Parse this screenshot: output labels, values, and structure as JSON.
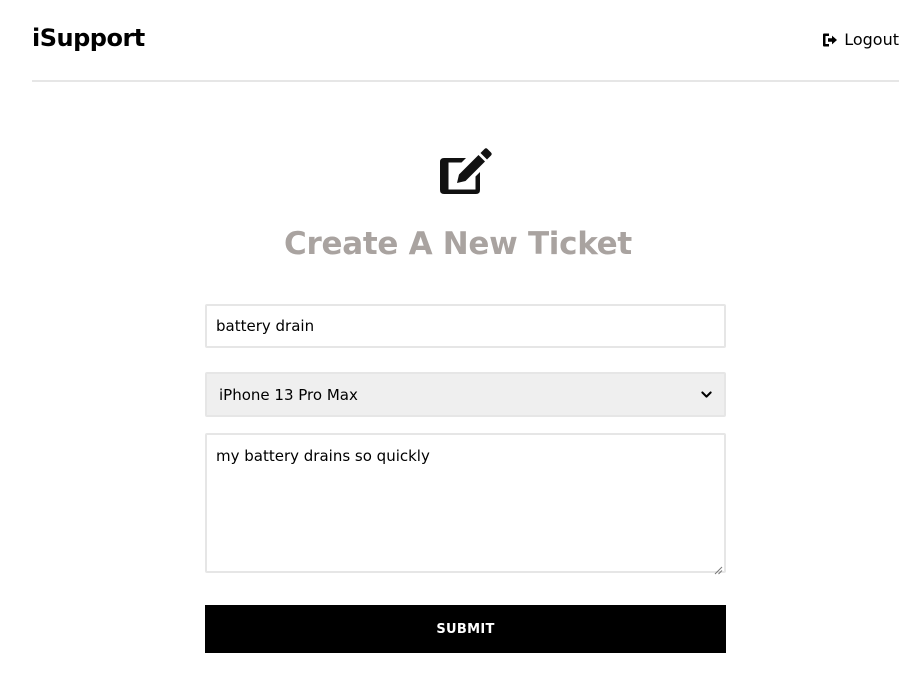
{
  "header": {
    "brand": "iSupport",
    "logout_label": "Logout",
    "logout_icon": "sign-out-icon"
  },
  "main": {
    "heading_icon": "edit-icon",
    "title": "Create A New Ticket"
  },
  "form": {
    "issue_title_value": "battery drain",
    "product_selected": "iPhone 13 Pro Max",
    "description_value": "my battery drains so quickly",
    "submit_label": "SUBMIT"
  },
  "colors": {
    "title": "#a9a3a0",
    "button_bg": "#000000",
    "border": "#e6e6e6",
    "select_bg": "#efefef"
  }
}
